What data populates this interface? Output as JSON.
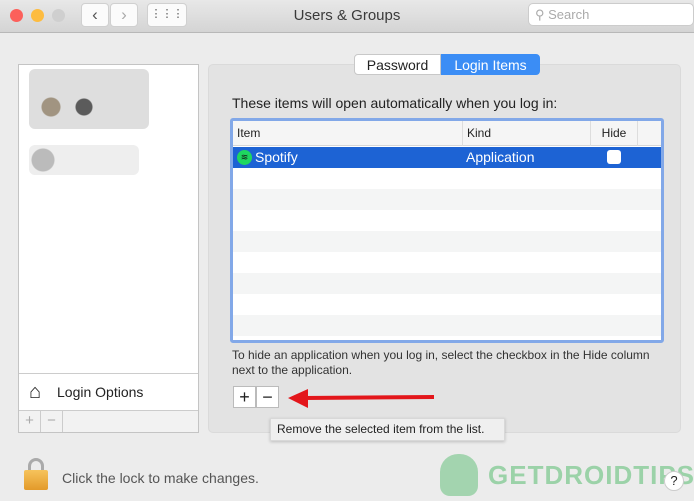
{
  "window": {
    "title": "Users & Groups",
    "search_placeholder": "Search",
    "back": "‹",
    "forward": "›",
    "grid": "⋮⋮⋮"
  },
  "tabs": [
    {
      "label": "Password",
      "selected": false
    },
    {
      "label": "Login Items",
      "selected": true
    }
  ],
  "accent": "#1d63d4",
  "login_items": {
    "heading": "These items will open automatically when you log in:",
    "columns": [
      "Item",
      "Kind",
      "Hide"
    ],
    "rows": [
      {
        "item": "Spotify",
        "kind": "Application",
        "hide": false,
        "selected": true
      }
    ],
    "hint": "To hide an application when you log in, select the checkbox in the Hide column next to the application.",
    "add": "+",
    "remove": "−",
    "tooltip": "Remove the selected item from the list."
  },
  "sidebar": {
    "login_options": "Login Options",
    "add": "+",
    "remove": "−"
  },
  "footer": {
    "lock_message": "Click the lock to make changes.",
    "help": "?"
  },
  "watermark": "GETDROIDTIPS"
}
